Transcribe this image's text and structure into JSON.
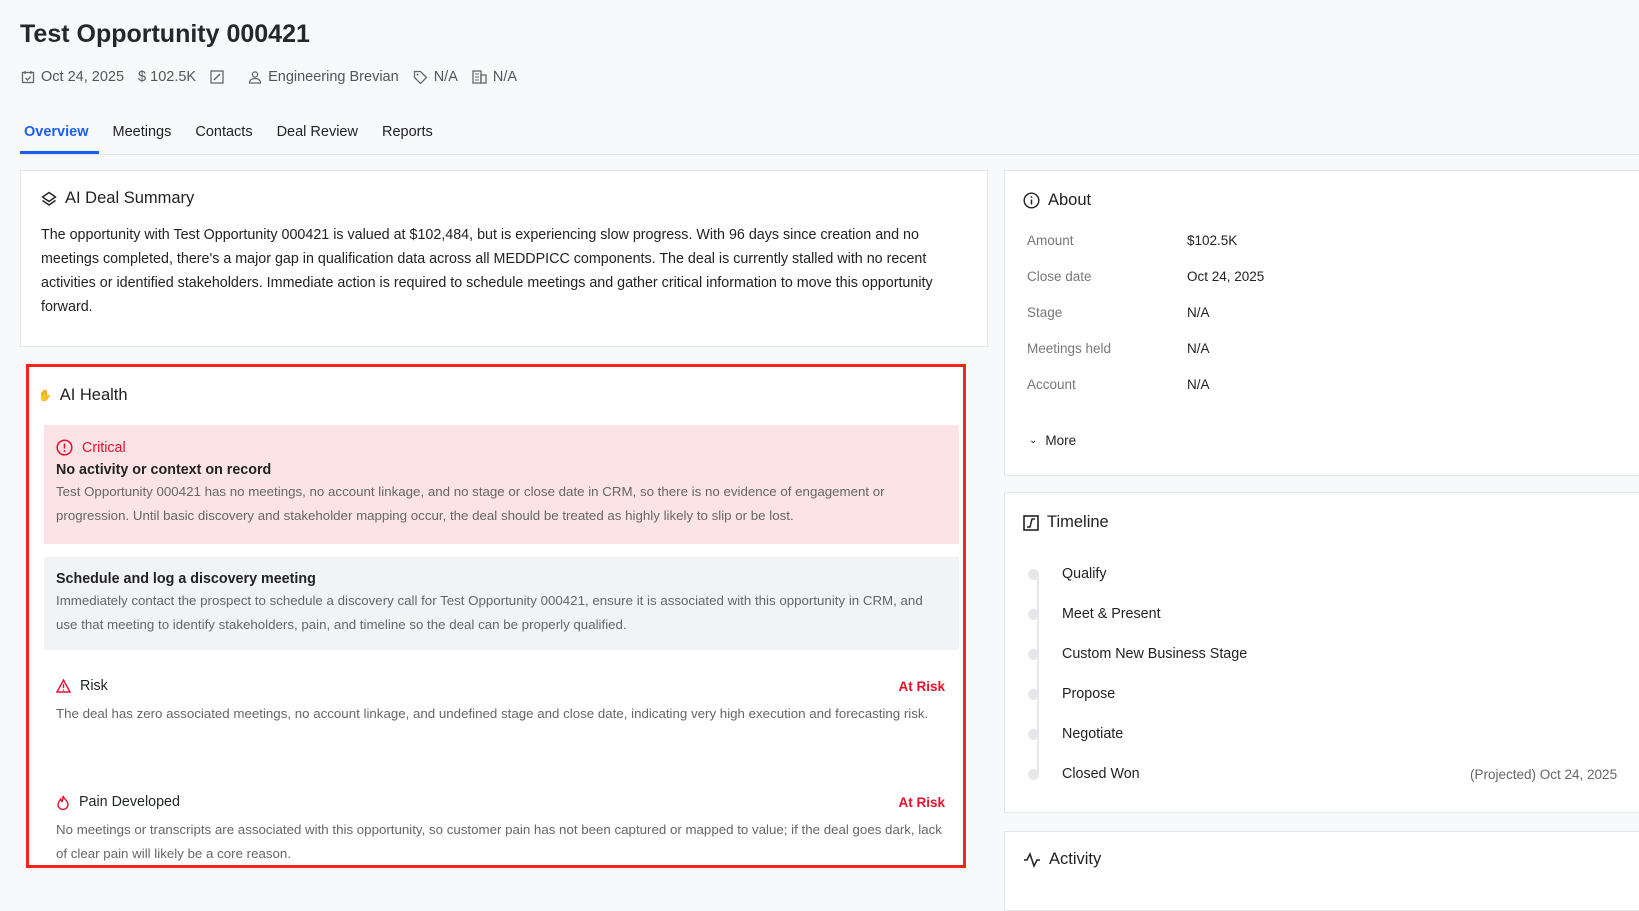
{
  "header": {
    "title": "Test Opportunity 000421",
    "close_date": "Oct 24, 2025",
    "amount": "$ 102.5K",
    "owner": "Engineering Brevian",
    "tag": "N/A",
    "account": "N/A"
  },
  "tabs": [
    {
      "label": "Overview",
      "active": true
    },
    {
      "label": "Meetings"
    },
    {
      "label": "Contacts"
    },
    {
      "label": "Deal Review"
    },
    {
      "label": "Reports"
    }
  ],
  "summary": {
    "title": "AI Deal Summary",
    "text": "The opportunity with Test Opportunity 000421 is valued at $102,484, but is experiencing slow progress. With 96 days since creation and no meetings completed, there's a major gap in qualification data across all MEDDPICC components. The deal is currently stalled with no recent activities or identified stakeholders. Immediate action is required to schedule meetings and gather critical information to move this opportunity forward."
  },
  "health": {
    "title": "AI Health",
    "critical": {
      "level": "Critical",
      "title": "No activity or context on record",
      "text": "Test Opportunity 000421 has no meetings, no account linkage, and no stage or close date in CRM, so there is no evidence of engagement or progression. Until basic discovery and stakeholder mapping occur, the deal should be treated as highly likely to slip or be lost."
    },
    "action": {
      "title": "Schedule and log a discovery meeting",
      "text": "Immediately contact the prospect to schedule a discovery call for Test Opportunity 000421, ensure it is associated with this opportunity in CRM, and use that meeting to identify stakeholders, pain, and timeline so the deal can be properly qualified."
    },
    "items": [
      {
        "title": "Risk",
        "status": "At Risk",
        "text": "The deal has zero associated meetings, no account linkage, and undefined stage and close date, indicating very high execution and forecasting risk."
      },
      {
        "title": "Pain Developed",
        "status": "At Risk",
        "text": "No meetings or transcripts are associated with this opportunity, so customer pain has not been captured or mapped to value; if the deal goes dark, lack of clear pain will likely be a core reason."
      }
    ],
    "accent": "#e3112d"
  },
  "about": {
    "title": "About",
    "rows": [
      {
        "label": "Amount",
        "value": "$102.5K"
      },
      {
        "label": "Close date",
        "value": "Oct 24, 2025"
      },
      {
        "label": "Stage",
        "value": "N/A"
      },
      {
        "label": "Meetings held",
        "value": "N/A"
      },
      {
        "label": "Account",
        "value": "N/A"
      }
    ],
    "more": "More"
  },
  "timeline": {
    "title": "Timeline",
    "stages": [
      {
        "label": "Qualify"
      },
      {
        "label": "Meet & Present"
      },
      {
        "label": "Custom New Business Stage"
      },
      {
        "label": "Propose"
      },
      {
        "label": "Negotiate"
      },
      {
        "label": "Closed Won",
        "date": "(Projected) Oct 24, 2025"
      }
    ]
  },
  "activity": {
    "title": "Activity"
  }
}
